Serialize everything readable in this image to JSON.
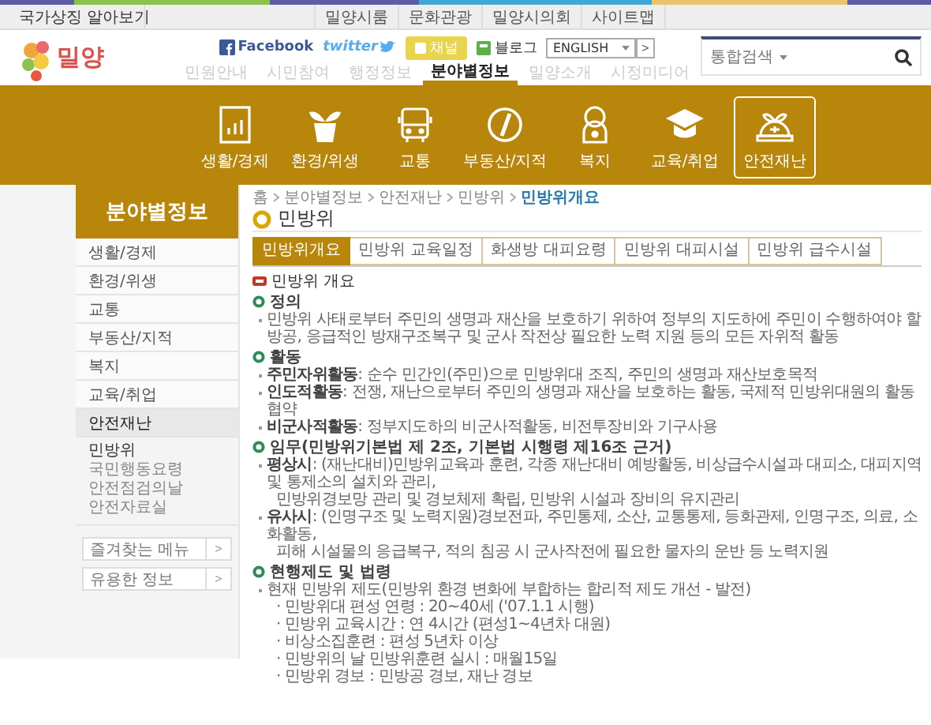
{
  "topbar": {
    "national_symbol": "국가상징 알아보기",
    "links": [
      "밀양시룸",
      "문화관광",
      "밀양시의회",
      "사이트맵"
    ]
  },
  "header": {
    "logo_text": "밀양",
    "social": [
      {
        "kind": "facebook",
        "label": "Facebook"
      },
      {
        "kind": "twitter",
        "label": "twitter"
      },
      {
        "kind": "channel",
        "label": "채널"
      },
      {
        "kind": "blog",
        "label": "블로그"
      }
    ],
    "language": "ENGLISH",
    "go": ">",
    "nav": [
      {
        "label": "민원안내",
        "selected": false
      },
      {
        "label": "시민참여",
        "selected": false
      },
      {
        "label": "행정정보",
        "selected": false
      },
      {
        "label": "분야별정보",
        "selected": true
      },
      {
        "label": "밀양소개",
        "selected": false
      },
      {
        "label": "시정미디어",
        "selected": false
      }
    ],
    "search": {
      "scope": "통합검색"
    }
  },
  "categories": [
    {
      "label": "생활/경제",
      "selected": false
    },
    {
      "label": "환경/위생",
      "selected": false
    },
    {
      "label": "교통",
      "selected": false
    },
    {
      "label": "부동산/지적",
      "selected": false
    },
    {
      "label": "복지",
      "selected": false
    },
    {
      "label": "교육/취업",
      "selected": false
    },
    {
      "label": "안전재난",
      "selected": true
    }
  ],
  "sidebar": {
    "title": "분야별정보",
    "items": [
      {
        "label": "생활/경제",
        "selected": false
      },
      {
        "label": "환경/위생",
        "selected": false
      },
      {
        "label": "교통",
        "selected": false
      },
      {
        "label": "부동산/지적",
        "selected": false
      },
      {
        "label": "복지",
        "selected": false
      },
      {
        "label": "교육/취업",
        "selected": false
      },
      {
        "label": "안전재난",
        "selected": true,
        "expanded": true,
        "children": [
          {
            "label": "민방위",
            "selected": true
          },
          {
            "label": "국민행동요령",
            "selected": false
          },
          {
            "label": "안전점검의날",
            "selected": false
          },
          {
            "label": "안전자료실",
            "selected": false
          }
        ]
      }
    ],
    "boxes": [
      {
        "label": "즐겨찾는 메뉴",
        "go": ">"
      },
      {
        "label": "유용한 정보",
        "go": ">"
      }
    ]
  },
  "content": {
    "breadcrumb": [
      "홈",
      "분야별정보",
      "안전재난",
      "민방위",
      "민방위개요"
    ],
    "title": "민방위",
    "tabs": [
      {
        "label": "민방위개요",
        "selected": true
      },
      {
        "label": "민방위 교육일정",
        "selected": false
      },
      {
        "label": "화생방 대피요령",
        "selected": false
      },
      {
        "label": "민방위 대피시설",
        "selected": false
      },
      {
        "label": "민방위 급수시설",
        "selected": false
      }
    ],
    "heading": "민방위 개요",
    "sections": [
      {
        "title": "정의",
        "items": [
          {
            "text": "민방위 사태로부터 주민의 생명과 재산을 보호하기 위하여 정부의 지도하에 주민이 수행하여야 할 방공, 응급적인 방재구조복구 및 군사 작전상 필요한 노력 지원 등의 모든 자위적 활동"
          }
        ]
      },
      {
        "title": "활동",
        "items": [
          {
            "text": "**주민자위활동**: 순수 민간인(주민)으로 민방위대 조직, 주민의 생명과 재산보호목적"
          },
          {
            "text": "**인도적활동**: 전쟁, 재난으로부터 주민의 생명과 재산을 보호하는 활동, 국제적 민방위대원의 활동 협약"
          },
          {
            "text": "**비군사적활동**: 정부지도하의 비군사적활동, 비전투장비와 기구사용"
          }
        ]
      },
      {
        "title": "임무(민방위기본법 제 2조, 기본법 시행령 제16조 근거)",
        "items": [
          {
            "text": "**평상시**: (재난대비)민방위교육과 훈련, 각종 재난대비 예방활동, 비상급수시설과 대피소, 대피지역 및 통제소의 설치와 관리,",
            "lines": [
              "민방위경보망 관리 및 경보체제 확립, 민방위 시설과 장비의 유지관리"
            ]
          },
          {
            "text": "**유사시**: (인명구조 및 노력지원)경보전파, 주민통제, 소산, 교통통제, 등화관제, 인명구조, 의료, 소화활동,",
            "lines": [
              "피해 시설물의 응급복구, 적의 침공 시 군사작전에 필요한 물자의 운반 등 노력지원"
            ]
          }
        ]
      },
      {
        "title": "현행제도 및 법령",
        "items": [
          {
            "text": "현재 민방위 제도(민방위 환경 변화에 부합하는 합리적 제도 개선 - 발전)",
            "lines": [
              "· 민방위대 편성 연령 : 20~40세 ('07.1.1 시행)",
              "· 민방위 교육시간 : 연 4시간 (편성1~4년차 대원)",
              "· 비상소집훈련 : 편성 5년차 이상",
              "· 민방위의 날 민방위훈련 실시 : 매월15일",
              "· 민방위 경보 : 민방공 경보, 재난 경보"
            ]
          }
        ]
      }
    ]
  }
}
